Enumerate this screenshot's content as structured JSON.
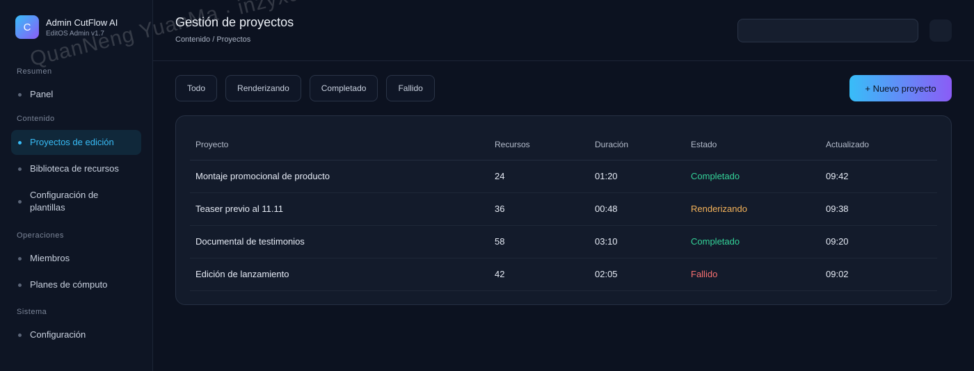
{
  "brand": {
    "logo_letter": "C",
    "name": "Admin CutFlow AI",
    "subtitle": "EditOS Admin v1.7"
  },
  "sidebar": {
    "sections": [
      {
        "heading": "Resumen",
        "items": [
          {
            "label": "Panel",
            "active": false
          }
        ]
      },
      {
        "heading": "Contenido",
        "items": [
          {
            "label": "Proyectos de edición",
            "active": true
          },
          {
            "label": "Biblioteca de recursos",
            "active": false
          },
          {
            "label": "Configuración de plantillas",
            "active": false
          }
        ]
      },
      {
        "heading": "Operaciones",
        "items": [
          {
            "label": "Miembros",
            "active": false
          },
          {
            "label": "Planes de cómputo",
            "active": false
          }
        ]
      },
      {
        "heading": "Sistema",
        "items": [
          {
            "label": "Configuración",
            "active": false
          }
        ]
      }
    ]
  },
  "header": {
    "title": "Gestión de proyectos",
    "breadcrumb": "Contenido / Proyectos"
  },
  "filters": [
    "Todo",
    "Renderizando",
    "Completado",
    "Fallido"
  ],
  "new_project_label": "+ Nuevo proyecto",
  "table": {
    "columns": [
      "Proyecto",
      "Recursos",
      "Duración",
      "Estado",
      "Actualizado"
    ],
    "rows": [
      {
        "project": "Montaje promocional de producto",
        "resources": "24",
        "duration": "01:20",
        "status": "Completado",
        "status_type": "done",
        "updated": "09:42"
      },
      {
        "project": "Teaser previo al 11.11",
        "resources": "36",
        "duration": "00:48",
        "status": "Renderizando",
        "status_type": "render",
        "updated": "09:38"
      },
      {
        "project": "Documental de testimonios",
        "resources": "58",
        "duration": "03:10",
        "status": "Completado",
        "status_type": "done",
        "updated": "09:20"
      },
      {
        "project": "Edición de lanzamiento",
        "resources": "42",
        "duration": "02:05",
        "status": "Fallido",
        "status_type": "fail",
        "updated": "09:02"
      }
    ]
  },
  "watermark": "QuanNeng YuanMa · inzyxuashop.com",
  "colors": {
    "accent": "#38bdf8",
    "accent2": "#8b5cf6",
    "done": "#34d399",
    "render": "#f5b35a",
    "fail": "#f87171",
    "background": "#0c1220"
  }
}
